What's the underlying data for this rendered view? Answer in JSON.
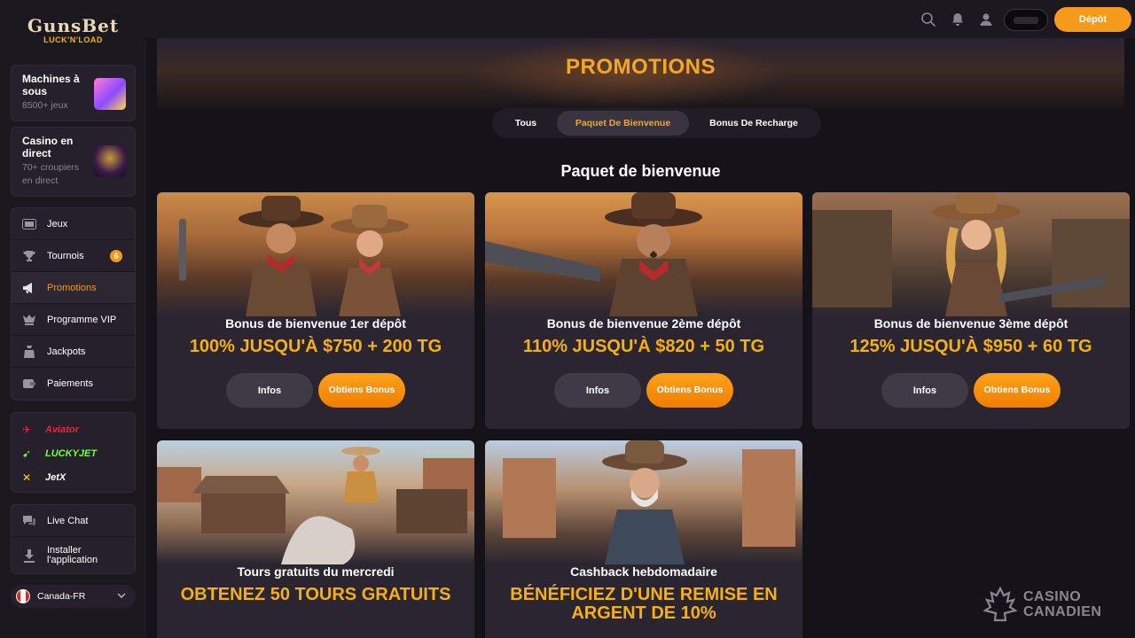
{
  "brand": {
    "name": "GunsBet",
    "tagline": "LUCK'N'LOAD"
  },
  "header": {
    "deposit_label": "Dépôt"
  },
  "sidebar": {
    "categories": [
      {
        "title": "Machines à sous",
        "subtitle": "8500+ jeux"
      },
      {
        "title": "Casino en direct",
        "subtitle": "70+ croupiers en direct"
      }
    ],
    "nav": [
      {
        "label": "Jeux",
        "icon": "gamepad-icon"
      },
      {
        "label": "Tournois",
        "icon": "trophy-icon",
        "badge": "6"
      },
      {
        "label": "Promotions",
        "icon": "megaphone-icon",
        "active": true
      },
      {
        "label": "Programme VIP",
        "icon": "vip-icon"
      },
      {
        "label": "Jackpots",
        "icon": "jackpot-icon"
      },
      {
        "label": "Paiements",
        "icon": "wallet-icon"
      }
    ],
    "games": [
      {
        "label": "Aviator",
        "color": "#e8243c"
      },
      {
        "label": "LUCKYJET",
        "color": "#7cff3a"
      },
      {
        "label": "JetX",
        "color": "#f5e000"
      }
    ],
    "support": [
      {
        "label": "Live Chat",
        "icon": "chat-icon"
      },
      {
        "label": "Installer l'application",
        "icon": "download-icon"
      }
    ],
    "language": "Canada-FR"
  },
  "main": {
    "page_title": "PROMOTIONS",
    "tabs": [
      {
        "label": "Tous"
      },
      {
        "label": "Paquet De Bienvenue",
        "active": true
      },
      {
        "label": "Bonus De Recharge"
      }
    ],
    "section_title": "Paquet de bienvenue",
    "promos": [
      {
        "title": "Bonus de bienvenue 1er dépôt",
        "offer": "100% JUSQU'À $750 + 200 TG",
        "info_label": "Infos",
        "cta_label": "Obtiens Bonus"
      },
      {
        "title": "Bonus de bienvenue 2ème dépôt",
        "offer": "110% JUSQU'À $820 + 50 TG",
        "info_label": "Infos",
        "cta_label": "Obtiens Bonus"
      },
      {
        "title": "Bonus de bienvenue 3ème dépôt",
        "offer": "125% JUSQU'À $950 + 60 TG",
        "info_label": "Infos",
        "cta_label": "Obtiens Bonus"
      },
      {
        "title": "Tours gratuits du mercredi",
        "offer": "OBTENEZ 50 TOURS GRATUITS"
      },
      {
        "title": "Cashback hebdomadaire",
        "offer": "BÉNÉFICIEZ D'UNE REMISE EN ARGENT DE 10%"
      }
    ]
  },
  "watermark": {
    "line1": "CASINO",
    "line2": "CANADIEN"
  },
  "colors": {
    "accent": "#f59a1a",
    "offer": "#f5b014",
    "bg": "#15121a",
    "card": "#2a2530"
  }
}
